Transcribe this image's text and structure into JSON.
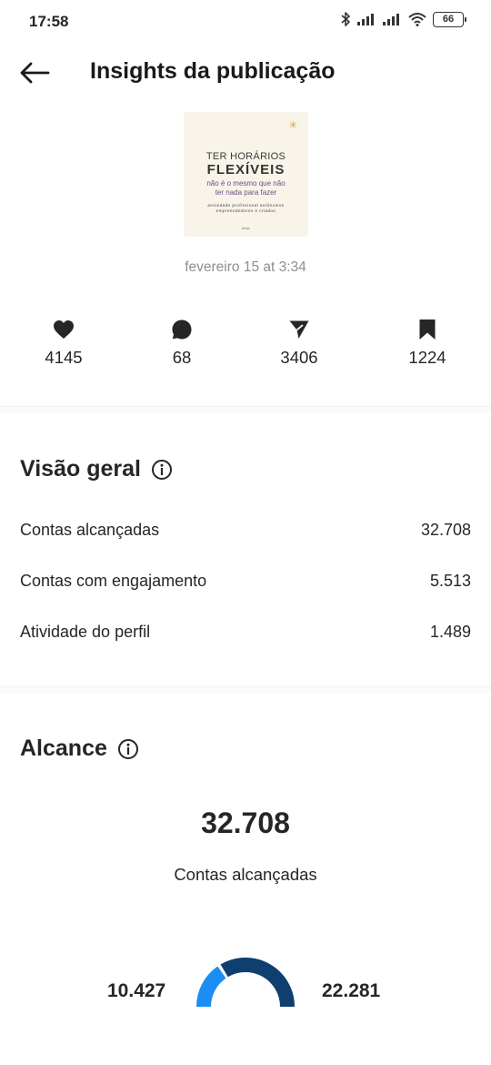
{
  "status_bar": {
    "time": "17:58",
    "battery": "66",
    "icons": [
      "bluetooth-icon",
      "signal-icon",
      "signal-icon",
      "wifi-icon",
      "battery-icon"
    ]
  },
  "header": {
    "title": "Insights da publicação",
    "back_icon": "arrow-left-icon"
  },
  "post": {
    "thumbnail_text": {
      "line1": "TER HORÁRIOS",
      "line2": "FLEXÍVEIS",
      "line3": "não é o mesmo que não",
      "line4": "ter nada para fazer",
      "line5": "ansiedade profissional autônomos",
      "line6": "empreendedores e criados",
      "line7": "beeye"
    },
    "date": "fevereiro 15 at 3:34"
  },
  "stats": [
    {
      "icon": "heart-icon",
      "value": "4145"
    },
    {
      "icon": "comment-icon",
      "value": "68"
    },
    {
      "icon": "send-icon",
      "value": "3406"
    },
    {
      "icon": "bookmark-icon",
      "value": "1224"
    }
  ],
  "overview": {
    "title": "Visão geral",
    "rows": [
      {
        "label": "Contas alcançadas",
        "value": "32.708"
      },
      {
        "label": "Contas com engajamento",
        "value": "5.513"
      },
      {
        "label": "Atividade do perfil",
        "value": "1.489"
      }
    ]
  },
  "reach": {
    "title": "Alcance",
    "total": "32.708",
    "caption": "Contas alcançadas",
    "left_value": "10.427",
    "right_value": "22.281",
    "left_fraction": 0.319,
    "colors": {
      "left": "#1a8ef2",
      "right": "#0e3f6e"
    }
  }
}
